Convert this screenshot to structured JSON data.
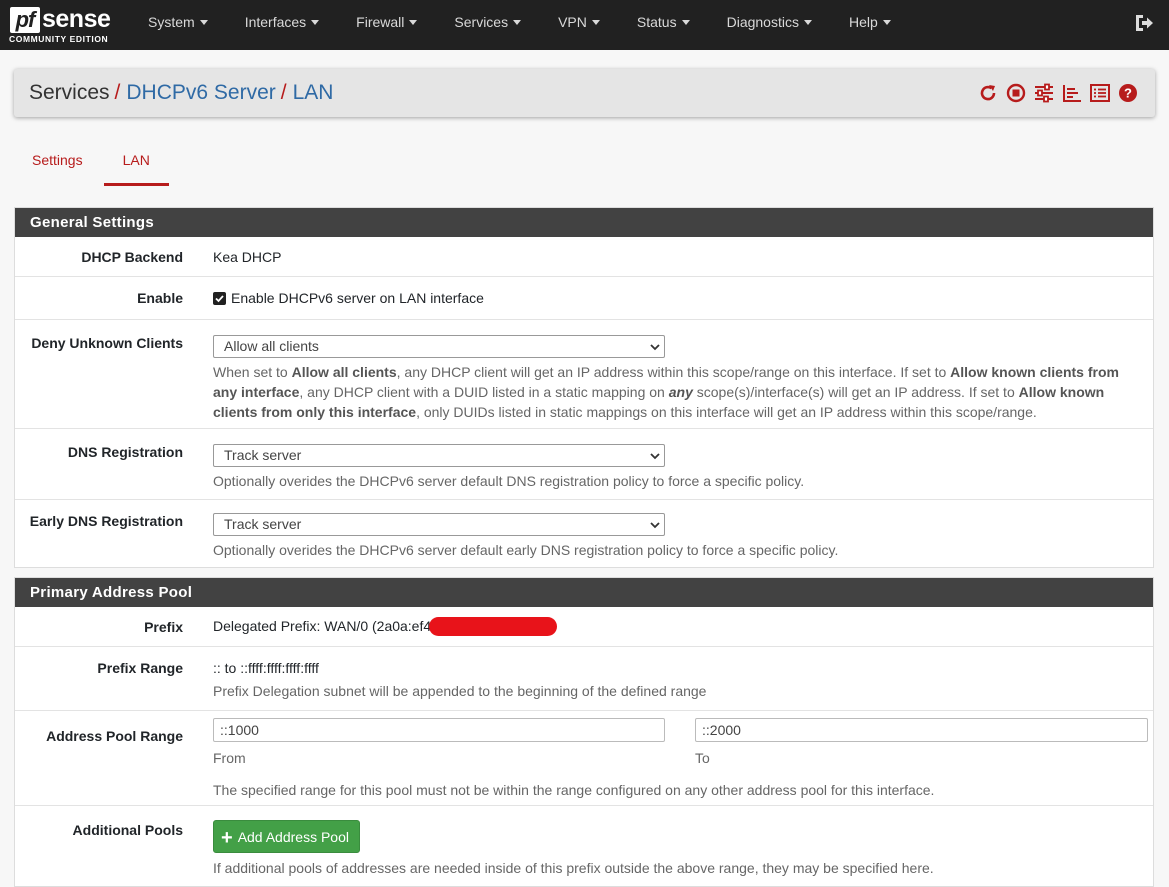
{
  "brand": {
    "logo_pf": "pf",
    "logo_sense": "sense",
    "edition": "COMMUNITY EDITION"
  },
  "nav": {
    "items": [
      "System",
      "Interfaces",
      "Firewall",
      "Services",
      "VPN",
      "Status",
      "Diagnostics",
      "Help"
    ],
    "logout_icon": "sign-out-icon"
  },
  "breadcrumb": {
    "root": "Services",
    "level1": "DHCPv6 Server",
    "level2": "LAN",
    "separator": "/"
  },
  "crumb_icons": [
    "refresh-icon",
    "stop-icon",
    "sliders-icon",
    "chart-icon",
    "list-icon",
    "help-icon"
  ],
  "tabs": [
    {
      "label": "Settings",
      "active": false
    },
    {
      "label": "LAN",
      "active": true
    }
  ],
  "general": {
    "heading": "General Settings",
    "backend_label": "DHCP Backend",
    "backend_value": "Kea DHCP",
    "enable_label": "Enable",
    "enable_text": "Enable DHCPv6 server on LAN interface",
    "enable_checked": true,
    "deny_label": "Deny Unknown Clients",
    "deny_value": "Allow all clients",
    "deny_help": {
      "p1": "When set to ",
      "b1": "Allow all clients",
      "p2": ", any DHCP client will get an IP address within this scope/range on this interface. If set to ",
      "b2": "Allow known clients from any interface",
      "p3": ", any DHCP client with a DUID listed in a static mapping on ",
      "b3": "any",
      "p4": " scope(s)/interface(s) will get an IP address. If set to ",
      "b4": "Allow known clients from only this interface",
      "p5": ", only DUIDs listed in static mappings on this interface will get an IP address within this scope/range."
    },
    "dns_label": "DNS Registration",
    "dns_value": "Track server",
    "dns_help": "Optionally overides the DHCPv6 server default DNS registration policy to force a specific policy.",
    "edns_label": "Early DNS Registration",
    "edns_value": "Track server",
    "edns_help": "Optionally overides the DHCPv6 server default early DNS registration policy to force a specific policy."
  },
  "pool": {
    "heading": "Primary Address Pool",
    "prefix_label": "Prefix",
    "prefix_value": "Delegated Prefix: WAN/0 (2a0a:ef4",
    "range_label": "Prefix Range",
    "range_value": ":: to ::ffff:ffff:ffff:ffff",
    "range_help": "Prefix Delegation subnet will be appended to the beginning of the defined range",
    "apr_label": "Address Pool Range",
    "from_value": "::1000",
    "from_label": "From",
    "to_value": "::2000",
    "to_label": "To",
    "apr_help": "The specified range for this pool must not be within the range configured on any other address pool for this interface.",
    "add_label": "Additional Pools",
    "add_button": "Add Address Pool",
    "add_help": "If additional pools of addresses are needed inside of this prefix outside the above range, they may be specified here."
  },
  "colors": {
    "accent_red": "#b71c1c",
    "link_blue": "#2f6aa5",
    "navbar": "#212121",
    "panel_heading": "#424242",
    "success": "#43a047"
  }
}
